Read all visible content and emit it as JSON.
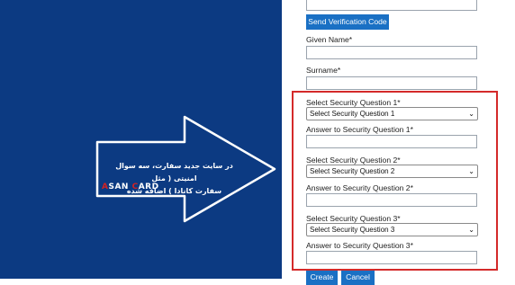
{
  "callout": {
    "line1": "در سایت جدید سفارت، سه سوال امنیتی ( مثل",
    "line2": "سفارت کانادا ) اضافه شده",
    "logo_part1": "A",
    "logo_part2": "SAN ",
    "logo_part3": "C",
    "logo_part4": "ARD"
  },
  "form": {
    "send_code_label": "Send Verification Code",
    "given_name_label": "Given Name*",
    "surname_label": "Surname*",
    "q1_label": "Select Security Question 1*",
    "q1_value": "Select Security Question 1",
    "a1_label": "Answer to Security Question 1*",
    "q2_label": "Select Security Question 2*",
    "q2_value": "Select Security Question 2",
    "a2_label": "Answer to Security Question 2*",
    "q3_label": "Select Security Question 3*",
    "q3_value": "Select Security Question 3",
    "a3_label": "Answer to Security Question 3*",
    "create_label": "Create",
    "cancel_label": "Cancel"
  },
  "colors": {
    "panel_bg": "#0c3a82",
    "button_bg": "#1a70c4",
    "highlight_border": "#d42a2a"
  },
  "icons": {
    "arrow": "arrow-right-icon",
    "chevron": "chevron-down-icon"
  }
}
